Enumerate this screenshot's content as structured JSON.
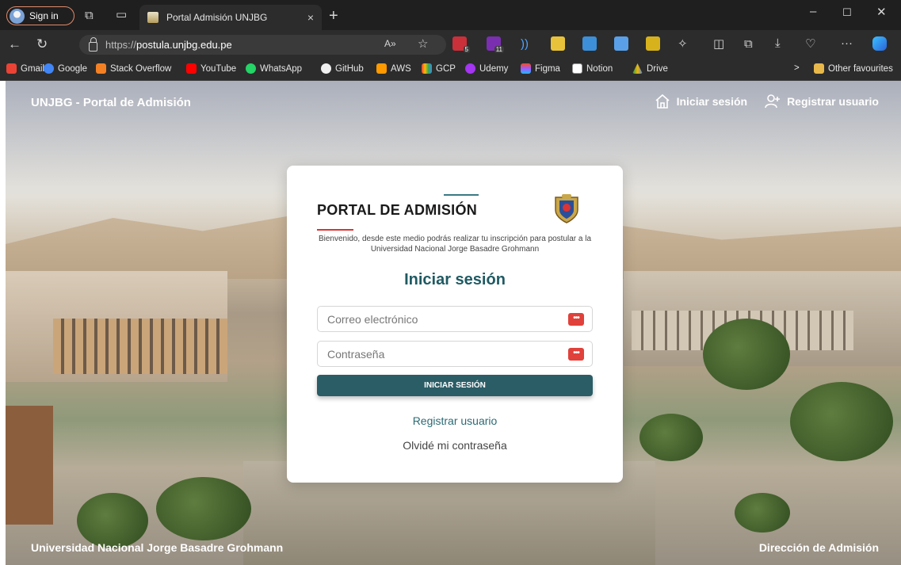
{
  "browser": {
    "signin_label": "Sign in",
    "tab_title": "Portal Admisión UNJBG",
    "tab_close": "×",
    "new_tab": "+",
    "url_scheme": "https://",
    "url_host": "postula.unjbg.edu.pe",
    "extension_badges": [
      "5",
      "11"
    ],
    "bookmarks": [
      "Gmail",
      "Google",
      "Stack Overflow",
      "YouTube",
      "WhatsApp",
      "GitHub",
      "AWS",
      "GCP",
      "Udemy",
      "Figma",
      "Notion",
      "Drive"
    ],
    "bookmarks_overflow": ">",
    "other_favourites": "Other favourites"
  },
  "page": {
    "brand": "UNJBG - Portal de Admisión",
    "nav": {
      "login": "Iniciar sesión",
      "register": "Registrar usuario"
    },
    "footer_left": "Universidad Nacional Jorge Basadre Grohmann",
    "footer_right": "Dirección de Admisión"
  },
  "card": {
    "title": "PORTAL DE ADMISIÓN",
    "description": "Bienvenido, desde este medio podrás realizar tu inscripción para postular a la Universidad Nacional Jorge Basadre Grohmann",
    "heading": "Iniciar sesión",
    "email_placeholder": "Correo electrónico",
    "password_placeholder": "Contraseña",
    "field_icon": "•••",
    "submit_label": "INICIAR SESIÓN",
    "register_link": "Registrar usuario",
    "forgot_link": "Olvidé mi contraseña"
  },
  "colors": {
    "primary": "#2b5d66",
    "accent_red": "#d33333",
    "link": "#2b6a74"
  }
}
